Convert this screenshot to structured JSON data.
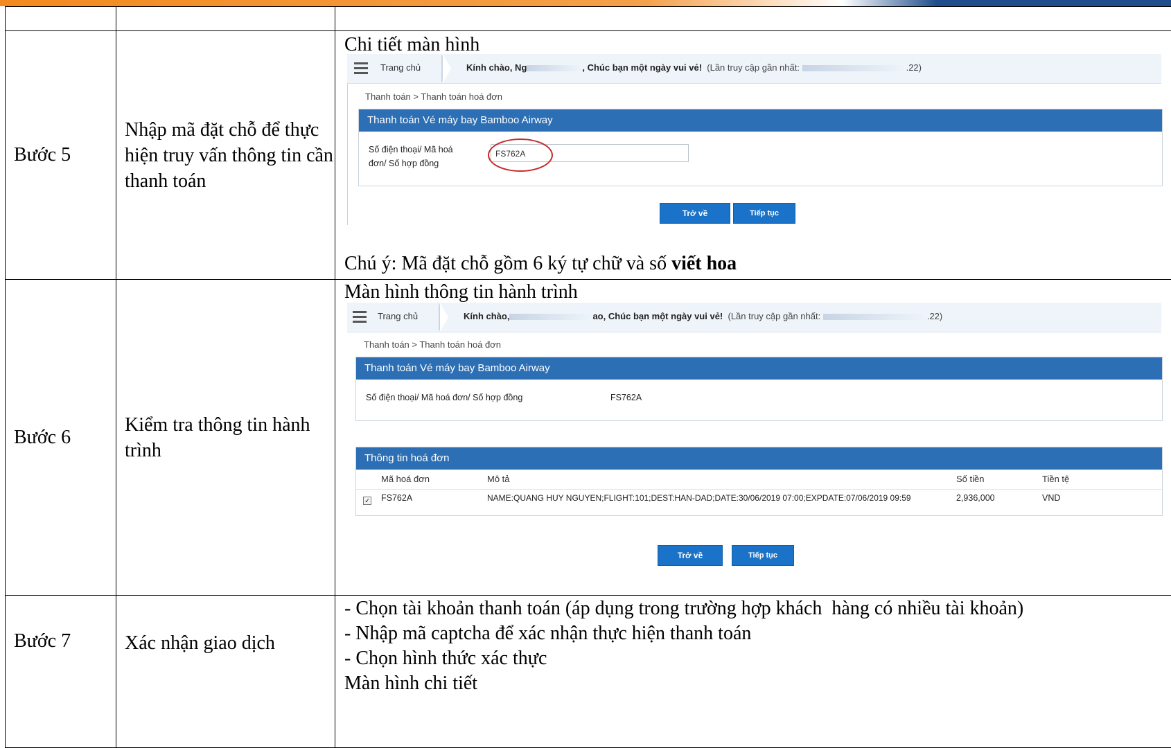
{
  "rows": [
    {
      "step": "",
      "desc": ""
    },
    {
      "step": "Bước 5",
      "desc": "Nhập mã đặt chỗ để thực hiện truy vấn thông tin cần thanh toán"
    },
    {
      "step": "Bước 6",
      "desc": "Kiểm tra thông tin hành trình"
    },
    {
      "step": "Bước 7",
      "desc": "Xác nhận giao dịch"
    }
  ],
  "step5": {
    "caption": "Chi tiết màn hình",
    "note_prefix": "Chú ý: Mã đặt chỗ gồm 6 ký tự chữ và số ",
    "note_bold": "viết hoa",
    "header": {
      "home": "Trang chủ",
      "greet_bold": "Kính chào, Ng",
      "greet_tail": ", Chúc bạn một ngày vui vẻ!",
      "last_access": "(Lần truy cập gần nhất:",
      "last_tail": ".22)"
    },
    "breadcrumb": "Thanh toán > Thanh toán hoá đơn",
    "panel_title": "Thanh toán Vé máy bay Bamboo Airway",
    "field_label_1": "Số điện thoại/ Mã hoá",
    "field_label_2": "đơn/ Số hợp đồng",
    "field_value": "FS762A",
    "btn_back": "Trở về",
    "btn_next": "Tiếp tục"
  },
  "step6": {
    "caption": "Màn hình thông tin hành trình",
    "header": {
      "home": "Trang chủ",
      "greet_bold": "Kính chào,",
      "greet_tail": "ao, Chúc bạn một ngày vui vẻ!",
      "last_access": "(Lần truy cập gần nhất:",
      "last_tail": ".22)"
    },
    "breadcrumb": "Thanh toán > Thanh toán hoá đơn",
    "panel_title": "Thanh toán Vé máy bay Bamboo Airway",
    "field_label": "Số điện thoại/ Mã hoá đơn/ Số hợp đồng",
    "field_value": "FS762A",
    "invoice_title": "Thông tin hoá đơn",
    "columns": [
      "Mã hoá đơn",
      "Mô tả",
      "Số tiền",
      "Tiền tệ"
    ],
    "invoice_row": {
      "code": "FS762A",
      "desc": "NAME:QUANG HUY NGUYEN;FLIGHT:101;DEST:HAN-DAD;DATE:30/06/2019 07:00;EXPDATE:07/06/2019 09:59",
      "amount": "2,936,000",
      "currency": "VND"
    },
    "btn_back": "Trở về",
    "btn_next": "Tiếp tục"
  },
  "step7": {
    "lines": [
      "- Chọn tài khoản thanh toán (áp dụng trong trường hợp khách  hàng có nhiều tài khoản)",
      "- Nhập mã captcha để xác nhận thực hiện thanh toán",
      "- Chọn hình thức xác thực",
      "Màn hình chi tiết"
    ]
  }
}
